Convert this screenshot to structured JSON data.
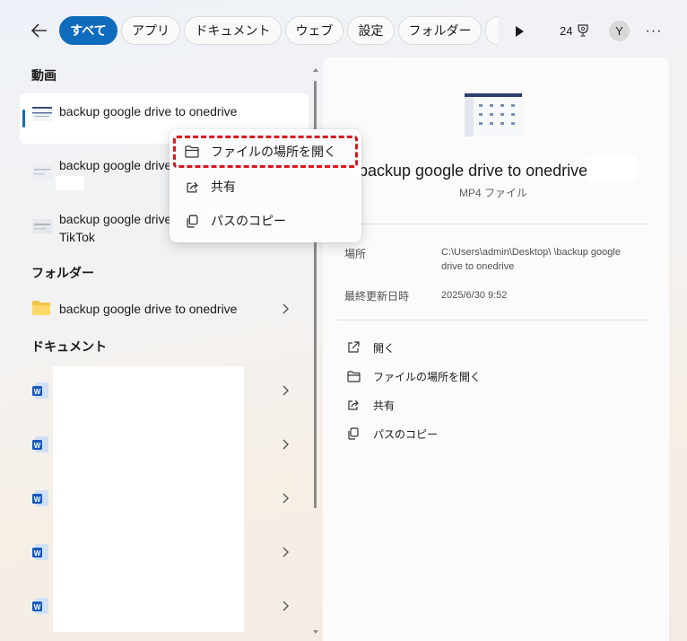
{
  "topbar": {
    "filters": [
      "すべて",
      "アプリ",
      "ドキュメント",
      "ウェブ",
      "設定",
      "フォルダー"
    ],
    "active_filter": "すべて",
    "points": "24",
    "avatar_initial": "Y"
  },
  "sections": {
    "videos": "動画",
    "folders": "フォルダー",
    "documents": "ドキュメント"
  },
  "video_results": [
    {
      "title": "backup google drive to onedrive"
    },
    {
      "title": "backup google drive"
    },
    {
      "title": "backup google drive",
      "subtitle": "TikTok"
    }
  ],
  "folder_results": [
    {
      "title": "backup google drive to onedrive"
    }
  ],
  "document_count": 5,
  "context_menu": {
    "items": [
      "ファイルの場所を開く",
      "共有",
      "パスのコピー"
    ]
  },
  "preview": {
    "title": "backup google drive to onedrive",
    "file_type": "MP4 ファイル",
    "location_label": "場所",
    "location_value": "C:\\Users\\admin\\Desktop\\      \\backup google drive to onedrive",
    "modified_label": "最終更新日時",
    "modified_value": "2025/6/30 9:52",
    "actions": [
      "開く",
      "ファイルの場所を開く",
      "共有",
      "パスのコピー"
    ]
  },
  "colors": {
    "accent": "#0f6cbd",
    "highlight": "#d9181f"
  }
}
